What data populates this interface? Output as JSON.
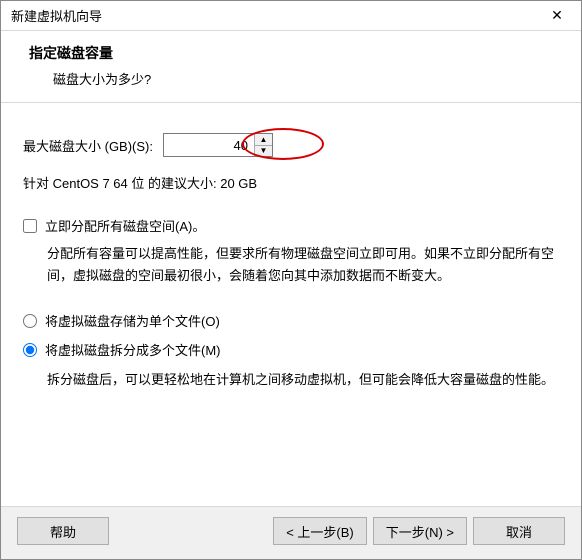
{
  "window": {
    "title": "新建虚拟机向导"
  },
  "header": {
    "heading": "指定磁盘容量",
    "sub": "磁盘大小为多少?"
  },
  "size": {
    "label": "最大磁盘大小 (GB)(S):",
    "value": "40"
  },
  "recommend": "针对 CentOS 7 64 位 的建议大小: 20 GB",
  "allocate": {
    "label": "立即分配所有磁盘空间(A)。",
    "desc": "分配所有容量可以提高性能，但要求所有物理磁盘空间立即可用。如果不立即分配所有空间，虚拟磁盘的空间最初很小，会随着您向其中添加数据而不断变大。"
  },
  "store": {
    "single": "将虚拟磁盘存储为单个文件(O)",
    "split": "将虚拟磁盘拆分成多个文件(M)",
    "split_desc": "拆分磁盘后，可以更轻松地在计算机之间移动虚拟机，但可能会降低大容量磁盘的性能。"
  },
  "footer": {
    "help": "帮助",
    "back": "< 上一步(B)",
    "next": "下一步(N) >",
    "cancel": "取消"
  }
}
